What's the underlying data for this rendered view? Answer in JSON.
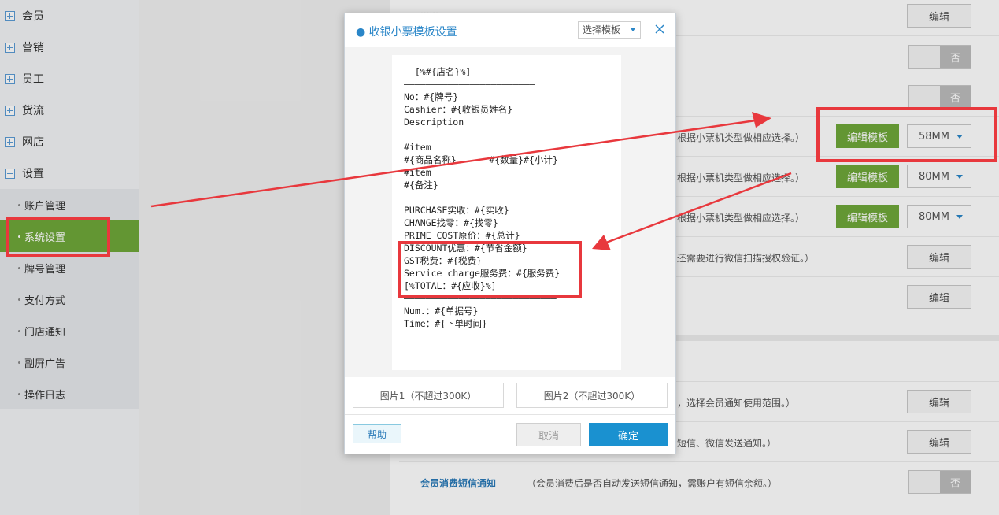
{
  "sidebar": {
    "menu": [
      {
        "label": "会员",
        "expanded": false
      },
      {
        "label": "营销",
        "expanded": false
      },
      {
        "label": "员工",
        "expanded": false
      },
      {
        "label": "货流",
        "expanded": false
      },
      {
        "label": "网店",
        "expanded": false
      },
      {
        "label": "设置",
        "expanded": true
      }
    ],
    "submenu": [
      "账户管理",
      "系统设置",
      "牌号管理",
      "支付方式",
      "门店通知",
      "副屏广告",
      "操作日志"
    ],
    "active_sub": "系统设置"
  },
  "settings": {
    "rows": [
      {
        "desc": "",
        "control": "编辑"
      },
      {
        "desc": "",
        "control": "否"
      },
      {
        "desc": "",
        "control": "否"
      },
      {
        "desc": "根据小票机类型做相应选择。）",
        "control": "编辑模板",
        "size": "58MM"
      },
      {
        "desc": "根据小票机类型做相应选择。）",
        "control": "编辑模板",
        "size": "80MM"
      },
      {
        "desc": "根据小票机类型做相应选择。）",
        "control": "编辑模板",
        "size": "80MM"
      },
      {
        "desc": "还需要进行微信扫描授权验证。）",
        "control": "编辑"
      },
      {
        "desc": "",
        "control": "编辑"
      },
      {
        "desc": "，选择会员通知使用范围。）",
        "control": "编辑"
      },
      {
        "desc": "短信、微信发送通知。）",
        "control": "编辑"
      },
      {
        "title": "会员消费短信通知",
        "desc": "（会员消费后是否自动发送短信通知，需账户有短信余额。）",
        "control": "否"
      }
    ]
  },
  "modal": {
    "title": "● 收银小票模板设置",
    "template_select": "选择模板",
    "receipt_lines": [
      "  [%#{店名}%]",
      "————————————————————————",
      "No：#{牌号}",
      "Cashier：#{收银员姓名}",
      "Description",
      "————————————————————————————",
      "#item",
      "#{商品名称}      #{数量}#{小计}",
      "#item",
      "#{备注}",
      "————————————————————————————",
      "PURCHASE实收：#{实收}",
      "CHANGE找零：#{找零}",
      "PRIME COST原价：#{总计}",
      "DISCOUNT优惠：#{节省金额}",
      "GST税费：#{税费}",
      "Service charge服务费：#{服务费}",
      "[%TOTAL：#{应收}%]",
      "————————————————————————————",
      "Num.：#{单据号}",
      "Time：#{下单时间}"
    ],
    "upload1": "图片1（不超过300K）",
    "upload2": "图片2（不超过300K）",
    "help": "帮助",
    "cancel": "取消",
    "ok": "确定"
  },
  "colors": {
    "accent_blue": "#2a86c8",
    "green": "#6fa839",
    "annotation_red": "#e8383d"
  }
}
